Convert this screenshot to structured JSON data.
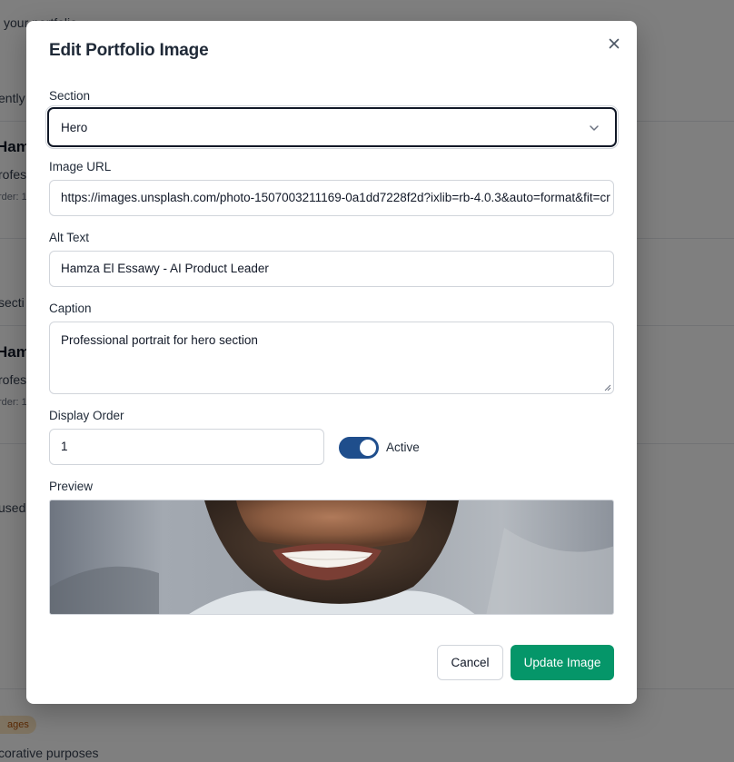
{
  "background": {
    "fragments": [
      "your portfolio",
      "ently",
      "Ham:",
      "rofes",
      "rder: 1",
      "secti",
      "Ham:",
      "rofes",
      "rder: 1",
      "used",
      "ages",
      "corative purposes"
    ]
  },
  "modal": {
    "title": "Edit Portfolio Image",
    "close_icon": "close-icon"
  },
  "form": {
    "section": {
      "label": "Section",
      "value": "Hero",
      "icon": "chevron-down-icon"
    },
    "image_url": {
      "label": "Image URL",
      "value": "https://images.unsplash.com/photo-1507003211169-0a1dd7228f2d?ixlib=rb-4.0.3&auto=format&fit=cr"
    },
    "alt_text": {
      "label": "Alt Text",
      "value": "Hamza El Essawy - AI Product Leader"
    },
    "caption": {
      "label": "Caption",
      "value": "Professional portrait for hero section"
    },
    "display_order": {
      "label": "Display Order",
      "value": "1"
    },
    "active": {
      "label": "Active",
      "on": true,
      "color": "#1f4e8c"
    },
    "preview": {
      "label": "Preview"
    }
  },
  "buttons": {
    "cancel": "Cancel",
    "update": "Update Image",
    "update_color": "#059669"
  }
}
